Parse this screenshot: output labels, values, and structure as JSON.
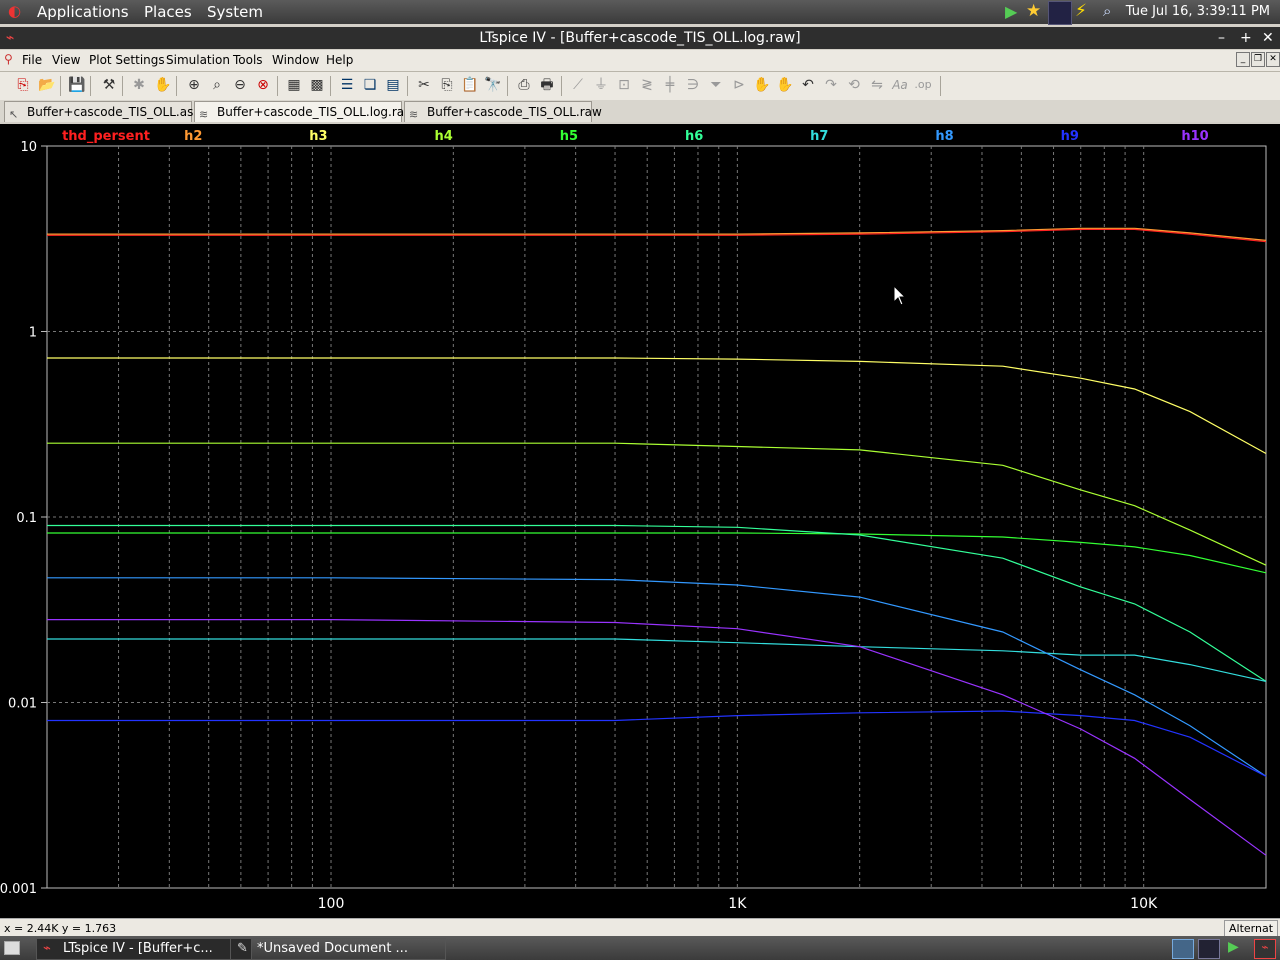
{
  "top_panel": {
    "applications": "Applications",
    "places": "Places",
    "system": "System",
    "clock": "Tue Jul 16,  3:39:11 PM"
  },
  "window": {
    "title": "LTspice IV - [Buffer+cascode_TIS_OLL.log.raw]"
  },
  "menu": [
    "File",
    "View",
    "Plot Settings",
    "Simulation",
    "Tools",
    "Window",
    "Help"
  ],
  "tabs": [
    {
      "label": "Buffer+cascode_TIS_OLL.asc",
      "icon": "schematic-icon"
    },
    {
      "label": "Buffer+cascode_TIS_OLL.log.raw",
      "icon": "waveform-icon"
    },
    {
      "label": "Buffer+cascode_TIS_OLL.raw",
      "icon": "waveform-icon"
    }
  ],
  "status": {
    "coords": "x = 2.44K    y = 1.763",
    "right": "Alternat"
  },
  "taskbar": [
    {
      "label": "LTspice IV - [Buffer+c...",
      "icon": "ltspice-icon"
    },
    {
      "label": "*Unsaved Document ...",
      "icon": "text-editor-icon"
    }
  ],
  "chart_data": {
    "type": "line",
    "x_scale": "log",
    "y_scale": "log",
    "xlim": [
      20,
      20000
    ],
    "ylim": [
      0.001,
      10
    ],
    "grid": true,
    "x_ticks": [
      {
        "v": 100,
        "label": "100"
      },
      {
        "v": 1000,
        "label": "1K"
      },
      {
        "v": 10000,
        "label": "10K"
      }
    ],
    "y_ticks": [
      {
        "v": 0.001,
        "label": "0.001"
      },
      {
        "v": 0.01,
        "label": "0.01"
      },
      {
        "v": 0.1,
        "label": "0.1"
      },
      {
        "v": 1,
        "label": "1"
      },
      {
        "v": 10,
        "label": "10"
      }
    ],
    "series": [
      {
        "name": "thd_persent",
        "color": "#ff2020",
        "x": [
          20,
          100,
          500,
          1000,
          2000,
          4500,
          7000,
          9500,
          13000,
          20000
        ],
        "y": [
          3.3,
          3.3,
          3.3,
          3.3,
          3.35,
          3.45,
          3.55,
          3.55,
          3.35,
          3.05
        ]
      },
      {
        "name": "h2",
        "color": "#ff9933",
        "x": [
          20,
          100,
          500,
          1000,
          2000,
          4500,
          7000,
          9500,
          13000,
          20000
        ],
        "y": [
          3.35,
          3.35,
          3.35,
          3.35,
          3.4,
          3.5,
          3.6,
          3.6,
          3.4,
          3.1
        ]
      },
      {
        "name": "h3",
        "color": "#ffff66",
        "x": [
          20,
          100,
          500,
          1000,
          2000,
          4500,
          7000,
          9500,
          13000,
          20000
        ],
        "y": [
          0.72,
          0.72,
          0.72,
          0.71,
          0.69,
          0.65,
          0.56,
          0.49,
          0.37,
          0.22
        ]
      },
      {
        "name": "h4",
        "color": "#aaff33",
        "x": [
          20,
          100,
          500,
          1000,
          2000,
          4500,
          7000,
          9500,
          13000,
          20000
        ],
        "y": [
          0.25,
          0.25,
          0.25,
          0.24,
          0.23,
          0.19,
          0.14,
          0.115,
          0.085,
          0.055
        ]
      },
      {
        "name": "h5",
        "color": "#33ff33",
        "x": [
          20,
          100,
          500,
          1000,
          2000,
          4500,
          7000,
          9500,
          13000,
          20000
        ],
        "y": [
          0.082,
          0.082,
          0.082,
          0.082,
          0.081,
          0.078,
          0.073,
          0.069,
          0.062,
          0.05
        ]
      },
      {
        "name": "h6",
        "color": "#33ff99",
        "x": [
          20,
          100,
          500,
          1000,
          2000,
          4500,
          7000,
          9500,
          13000,
          20000
        ],
        "y": [
          0.09,
          0.09,
          0.09,
          0.088,
          0.08,
          0.06,
          0.042,
          0.034,
          0.024,
          0.013
        ]
      },
      {
        "name": "h7",
        "color": "#33dddd",
        "x": [
          20,
          100,
          500,
          1000,
          2000,
          4500,
          7000,
          9500,
          13000,
          20000
        ],
        "y": [
          0.022,
          0.022,
          0.022,
          0.021,
          0.02,
          0.019,
          0.018,
          0.018,
          0.016,
          0.013
        ]
      },
      {
        "name": "h8",
        "color": "#3399ff",
        "x": [
          20,
          100,
          500,
          1000,
          2000,
          4500,
          7000,
          9500,
          13000,
          20000
        ],
        "y": [
          0.047,
          0.047,
          0.046,
          0.043,
          0.037,
          0.024,
          0.015,
          0.011,
          0.0075,
          0.004
        ]
      },
      {
        "name": "h9",
        "color": "#2233ff",
        "x": [
          20,
          100,
          500,
          1000,
          2000,
          4500,
          7000,
          9500,
          13000,
          20000
        ],
        "y": [
          0.008,
          0.008,
          0.008,
          0.0085,
          0.0088,
          0.009,
          0.0085,
          0.008,
          0.0065,
          0.004
        ]
      },
      {
        "name": "h10",
        "color": "#9933ff",
        "x": [
          20,
          100,
          500,
          1000,
          2000,
          4500,
          7000,
          9500,
          13000,
          20000
        ],
        "y": [
          0.028,
          0.028,
          0.027,
          0.025,
          0.02,
          0.011,
          0.0072,
          0.005,
          0.003,
          0.0015
        ]
      }
    ]
  }
}
